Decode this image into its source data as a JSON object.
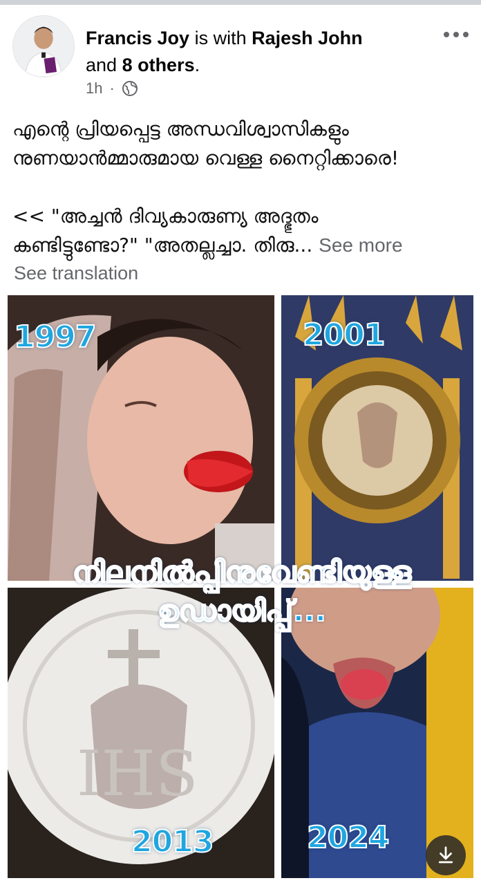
{
  "post": {
    "author": "Francis Joy",
    "with_text": " is with ",
    "tagged_user": "Rajesh John",
    "and_text": "and ",
    "others_count": "8 others",
    "period": ".",
    "time": "1h",
    "dot": "·",
    "text_line1": "എന്റെ പ്രിയപ്പെട്ട അന്ധവിശ്വാസികളും",
    "text_line2": "നുണയാൻമ്മാരുമായ വെള്ള നൈറ്റിക്കാരെ!",
    "text_line3": "<< \"അച്ചൻ ദിവ്യകാരുണ്യ അദ്ഭുതം",
    "text_line4": "കണ്ടിട്ടുണ്ടോ?\" \"അതല്ലച്ചാ. തിരു...",
    "see_more": "See more",
    "see_translation": "See translation"
  },
  "image": {
    "year1": "1997",
    "year2": "2001",
    "year3": "2013",
    "year4": "2024",
    "overlay_line1": "നിലനിൽപ്പിനുവേണ്ടിയുള്ള",
    "overlay_line2": "ഉഡായിപ്പ്..."
  },
  "icons": {
    "more": "more-options-icon",
    "privacy": "globe-icon",
    "download": "download-icon"
  },
  "colors": {
    "accent_text": "#1aa3e4",
    "meta_gray": "#65676b"
  }
}
